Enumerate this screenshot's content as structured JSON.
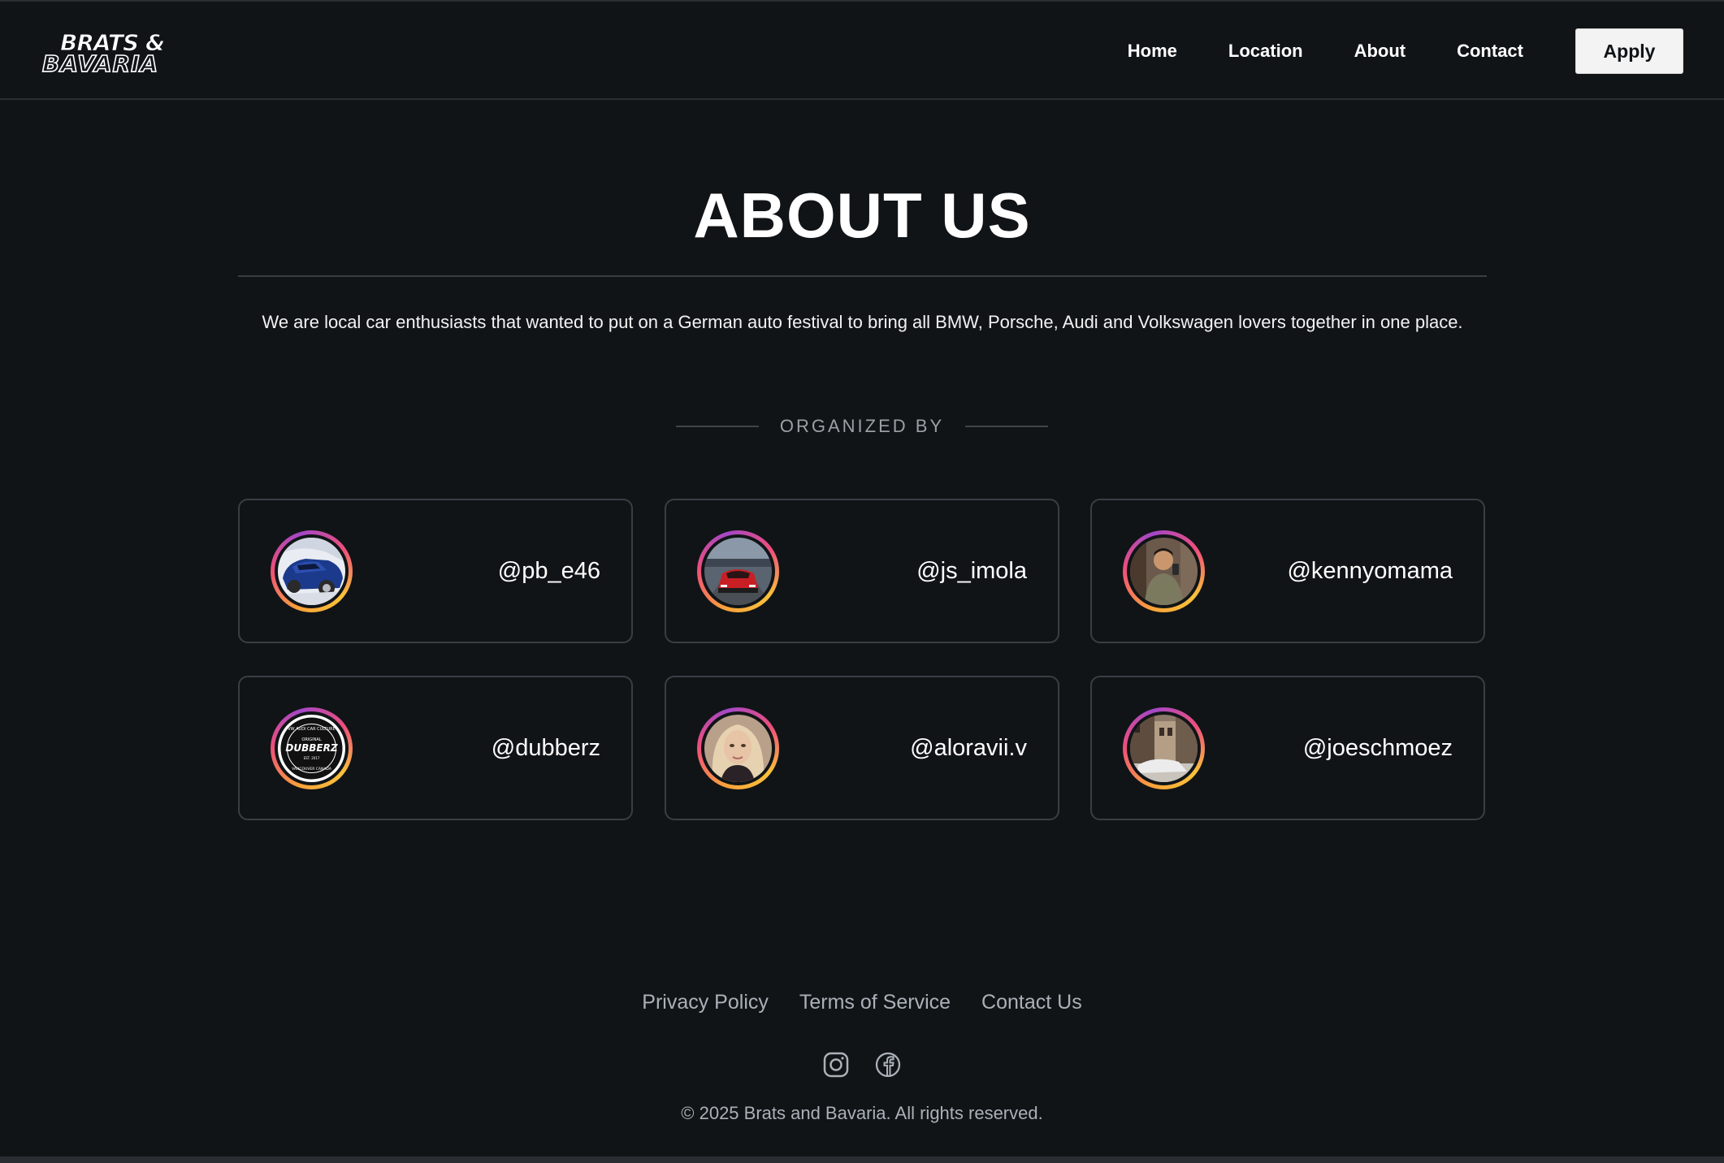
{
  "header": {
    "logo_line1": "BRATS &",
    "logo_line2": "BAVARIA",
    "nav": [
      "Home",
      "Location",
      "About",
      "Contact"
    ],
    "apply_label": "Apply"
  },
  "about": {
    "title": "ABOUT US",
    "description": "We are local car enthusiasts that wanted to put on a German auto festival to bring all BMW, Porsche, Audi and Volkswagen lovers together in one place.",
    "organized_by": "ORGANIZED BY"
  },
  "organizers": [
    {
      "handle": "@pb_e46"
    },
    {
      "handle": "@js_imola"
    },
    {
      "handle": "@kennyomama"
    },
    {
      "handle": "@dubberz"
    },
    {
      "handle": "@aloravii.v"
    },
    {
      "handle": "@joeschmoez"
    }
  ],
  "dubberz_badge": {
    "top": "VW AUDI CAR CULTURE",
    "small": "ORIGINAL",
    "name": "DUBBERZ",
    "est": "EST. 2017",
    "bottom": "VANCOUVER CANADA"
  },
  "footer": {
    "links": [
      "Privacy Policy",
      "Terms of Service",
      "Contact Us"
    ],
    "socials": [
      "instagram-icon",
      "facebook-icon"
    ],
    "copyright": "© 2025 Brats and Bavaria. All rights reserved."
  },
  "colors": {
    "background": "#111417",
    "border": "#3a3e44",
    "muted_text": "#aab1b8",
    "apply_bg": "#f3f3f3",
    "ring_gradient": [
      "#f9a13a",
      "#ee4f7b",
      "#a347c8"
    ]
  }
}
